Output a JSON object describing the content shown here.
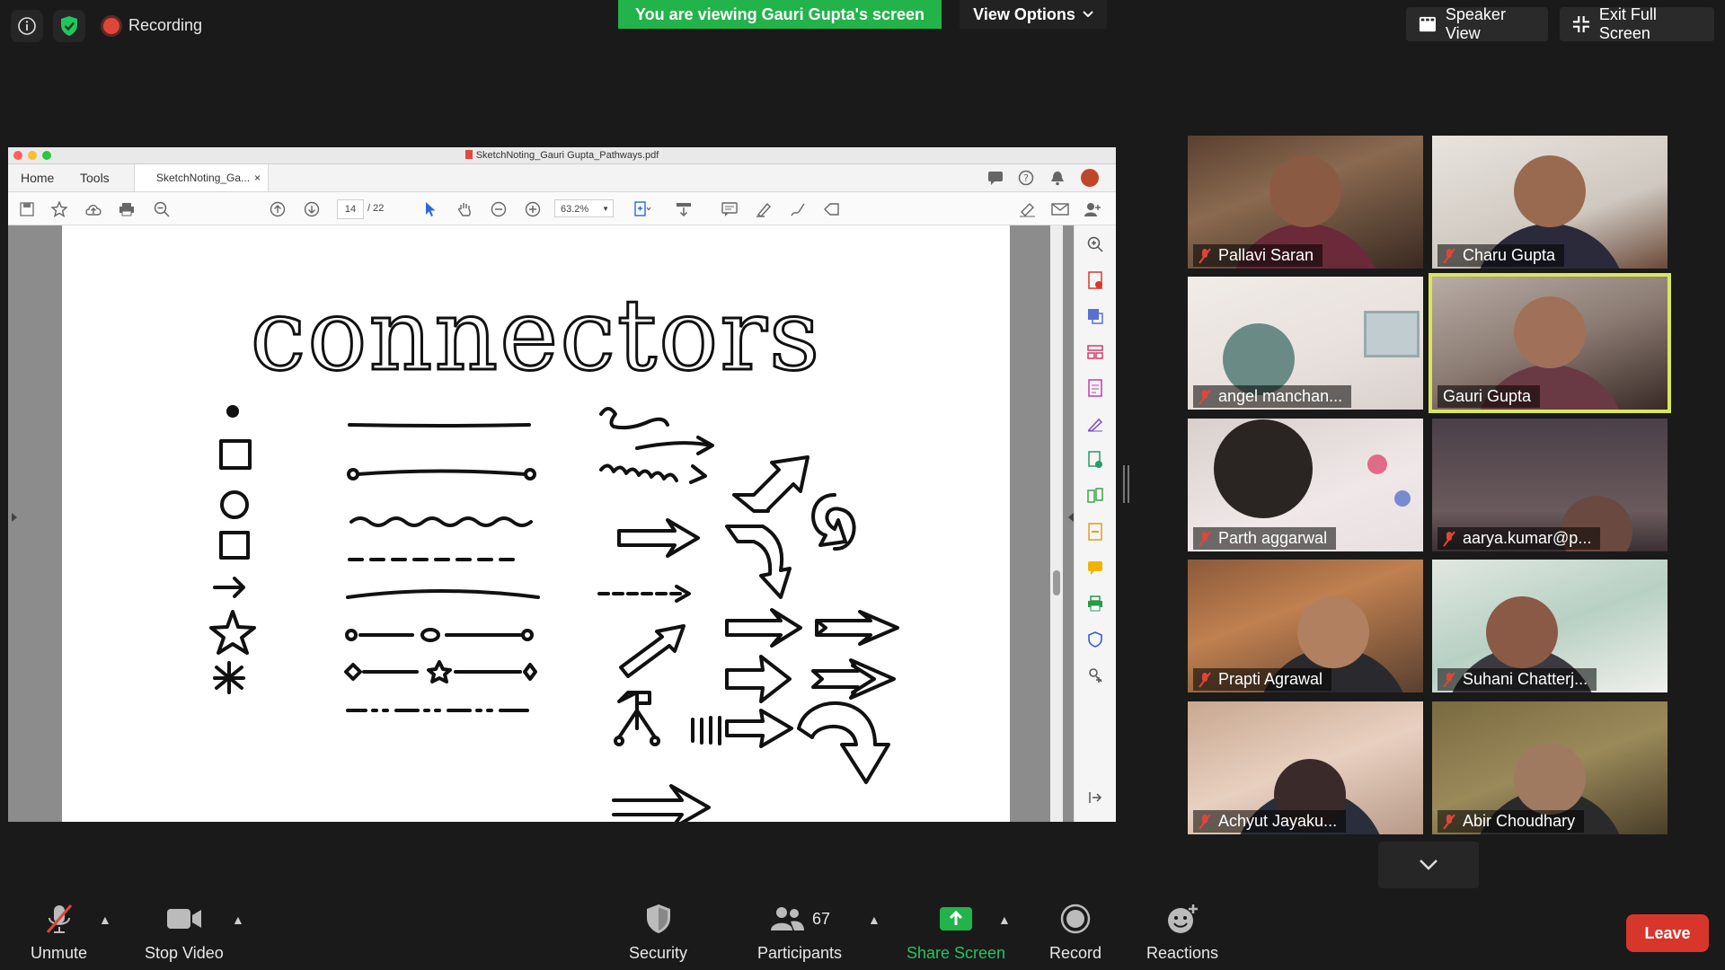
{
  "top": {
    "recording_label": "Recording",
    "banner_text": "You are viewing Gauri Gupta's screen",
    "view_options_label": "View Options",
    "speaker_view_label": "Speaker View",
    "exit_fullscreen_label": "Exit Full Screen"
  },
  "pdf": {
    "window_title": "SketchNoting_Gauri Gupta_Pathways.pdf",
    "tab_home": "Home",
    "tab_tools": "Tools",
    "doc_tab": "SketchNoting_Ga...",
    "doc_tab_close": "×",
    "page_current": "14",
    "page_total": "/ 22",
    "zoom": "63.2%",
    "heading": "connectors"
  },
  "participants": [
    {
      "name": "Pallavi Saran",
      "muted": true
    },
    {
      "name": "Charu Gupta",
      "muted": true
    },
    {
      "name": "angel manchan...",
      "muted": true
    },
    {
      "name": "Gauri Gupta",
      "muted": false,
      "active": true
    },
    {
      "name": "Parth aggarwal",
      "muted": true
    },
    {
      "name": "aarya.kumar@p...",
      "muted": true
    },
    {
      "name": "Prapti Agrawal",
      "muted": true
    },
    {
      "name": "Suhani Chatterj...",
      "muted": true
    },
    {
      "name": "Achyut Jayaku...",
      "muted": true
    },
    {
      "name": "Abir Choudhary",
      "muted": true
    }
  ],
  "bottom": {
    "unmute": "Unmute",
    "stop_video": "Stop Video",
    "security": "Security",
    "participants": "Participants",
    "participants_count": "67",
    "share_screen": "Share Screen",
    "record": "Record",
    "reactions": "Reactions",
    "leave": "Leave"
  },
  "colors": {
    "banner_green": "#22b44b",
    "leave_red": "#d9362b",
    "active_speaker": "#d8e65a",
    "share_green": "#22b44b"
  }
}
